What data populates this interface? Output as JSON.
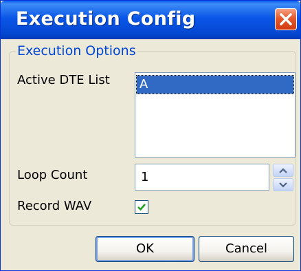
{
  "window": {
    "title": "Execution Config"
  },
  "group": {
    "legend": "Execution Options"
  },
  "fields": {
    "active_dte_label": "Active DTE List",
    "active_dte_items": [
      "A"
    ],
    "loop_count_label": "Loop Count",
    "loop_count_value": "1",
    "record_wav_label": "Record WAV",
    "record_wav_checked": true
  },
  "buttons": {
    "ok": "OK",
    "cancel": "Cancel"
  },
  "icons": {
    "close": "close-icon",
    "spin_up": "chevron-up-icon",
    "spin_down": "chevron-down-icon",
    "check": "checkmark-icon"
  },
  "colors": {
    "title_bar": "#0a56e8",
    "close_button": "#e5582d",
    "selection": "#316ac5",
    "legend_text": "#0046d5",
    "checkmark": "#21a121"
  }
}
